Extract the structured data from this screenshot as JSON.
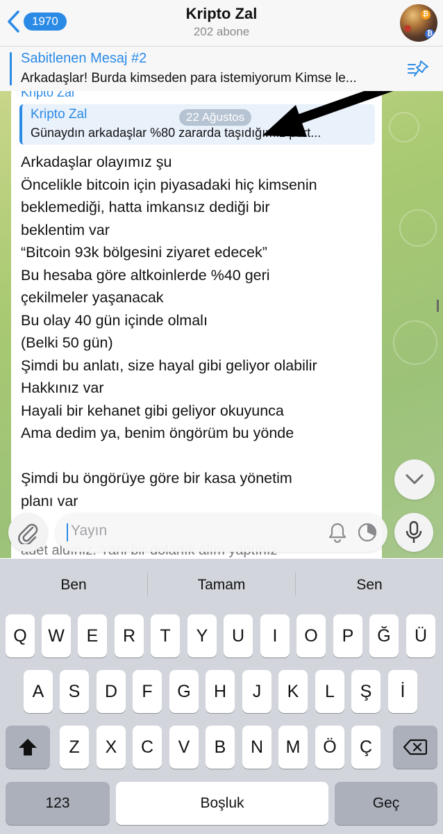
{
  "header": {
    "back_count": "1970",
    "title": "Kripto Zal",
    "subtitle": "202 abone"
  },
  "pinned": {
    "title": "Sabitlenen Mesaj #2",
    "text": "Arkadaşlar! Burda kimseden para istemiyorum Kimse le..."
  },
  "message": {
    "sender": "Kripto Zal",
    "reply": {
      "name": "Kripto Zal",
      "text": "Günaydın arkadaşlar %80 zararda taşıdığımız port..."
    },
    "date": "22 Ağustos",
    "lines": [
      "Arkadaşlar olayımız şu",
      "Öncelikle bitcoin için piyasadaki hiç kimsenin",
      "beklemediği, hatta imkansız dediği bir",
      "beklentim var",
      "“Bitcoin 93k bölgesini ziyaret edecek”",
      "Bu hesaba göre altkoinlerde %40 geri",
      "çekilmeler yaşanacak",
      "Bu olay 40 gün içinde olmalı",
      "(Belki 50 gün)",
      "Şimdi bu anlatı, size hayal gibi geliyor olabilir",
      "Hakkınız var",
      "Hayali bir kehanet gibi geliyor okuyunca",
      "Ama dedim ya, benim öngörüm bu yönde",
      "",
      "Şimdi bu öngörüye göre bir kasa yönetim",
      "planı var"
    ],
    "below_text": "adet aldınız. Yani bir dolarlık alım yaptınız"
  },
  "input": {
    "placeholder": "Yayın"
  },
  "keyboard": {
    "suggestions": [
      "Ben",
      "Tamam",
      "Sen"
    ],
    "row1": [
      "Q",
      "W",
      "E",
      "R",
      "T",
      "Y",
      "U",
      "I",
      "O",
      "P",
      "Ğ",
      "Ü"
    ],
    "row2": [
      "A",
      "S",
      "D",
      "F",
      "G",
      "H",
      "J",
      "K",
      "L",
      "Ş",
      "İ"
    ],
    "row3": [
      "Z",
      "X",
      "C",
      "V",
      "B",
      "N",
      "M",
      "Ö",
      "Ç"
    ],
    "numbers_label": "123",
    "space_label": "Boşluk",
    "return_label": "Geç"
  },
  "colors": {
    "accent": "#2b8ae6",
    "chat_bg": "#a9c972",
    "keyboard_bg": "#d2d5db"
  }
}
